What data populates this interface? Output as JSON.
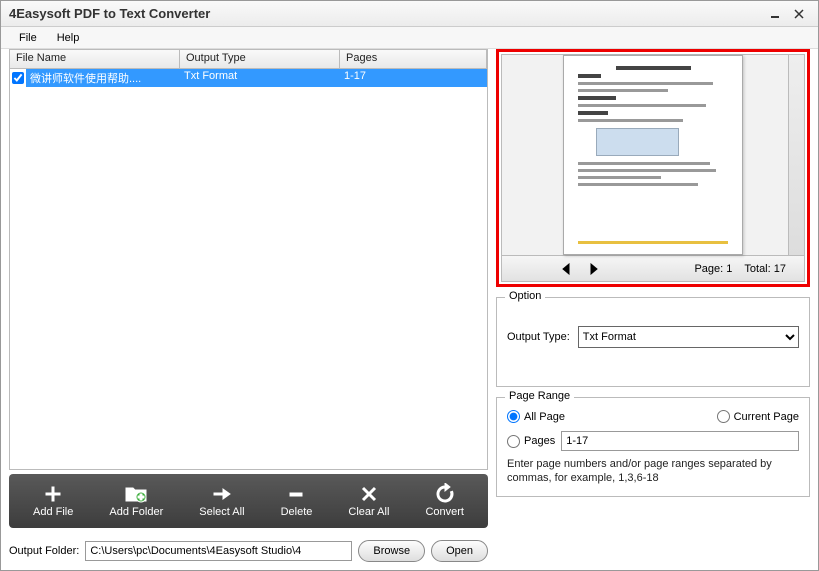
{
  "window": {
    "title": "4Easysoft PDF to Text Converter"
  },
  "menu": {
    "file": "File",
    "help": "Help"
  },
  "list": {
    "headers": {
      "filename": "File Name",
      "output": "Output Type",
      "pages": "Pages"
    },
    "rows": [
      {
        "checked": true,
        "filename": "微讲师软件使用帮助....",
        "output": "Txt Format",
        "pages": "1-17"
      }
    ]
  },
  "toolbar": {
    "addfile": "Add File",
    "addfolder": "Add Folder",
    "selectall": "Select All",
    "delete": "Delete",
    "clearall": "Clear All",
    "convert": "Convert"
  },
  "output": {
    "label": "Output Folder:",
    "path": "C:\\Users\\pc\\Documents\\4Easysoft Studio\\4",
    "browse": "Browse",
    "open": "Open"
  },
  "preview": {
    "page_label": "Page:",
    "page_num": "1",
    "total_label": "Total:",
    "total_num": "17"
  },
  "option": {
    "legend": "Option",
    "type_label": "Output Type:",
    "type_value": "Txt Format"
  },
  "pagerange": {
    "legend": "Page Range",
    "all": "All Page",
    "current": "Current Page",
    "pages_label": "Pages",
    "pages_value": "1-17",
    "hint": "Enter page numbers and/or page ranges separated by commas, for example, 1,3,6-18"
  }
}
